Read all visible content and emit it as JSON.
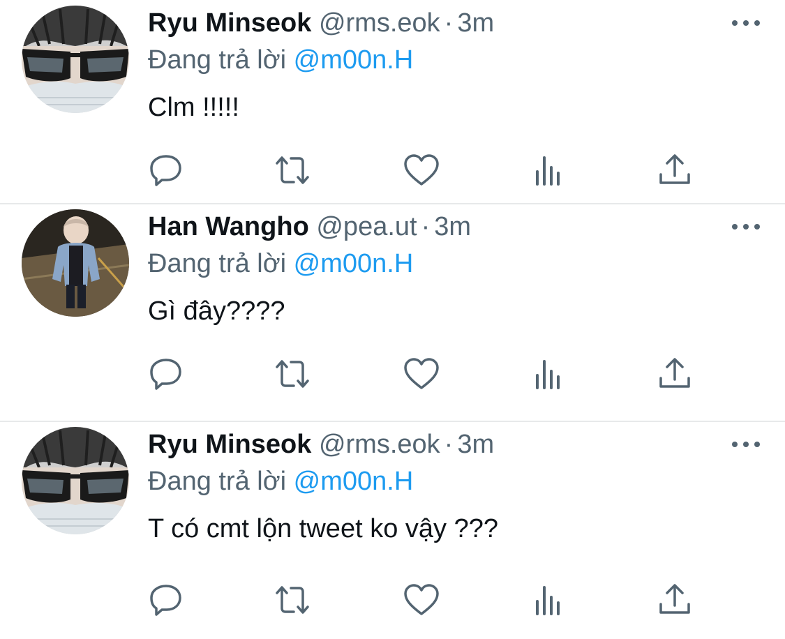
{
  "colors": {
    "text": "#0f1419",
    "secondary": "#536471",
    "link": "#1d9bf0",
    "divider": "#e7e9ea",
    "icon": "#536471"
  },
  "tweets": [
    {
      "name": "Ryu Minseok",
      "handle": "@rms.eok",
      "separator": "·",
      "time": "3m",
      "reply_prefix": "Đang trả lời",
      "reply_to": "@m00n.H",
      "text": "Clm !!!!!",
      "avatar": "avatar-sunglasses-mask"
    },
    {
      "name": "Han Wangho",
      "handle": "@pea.ut",
      "separator": "·",
      "time": "3m",
      "reply_prefix": "Đang trả lời",
      "reply_to": "@m00n.H",
      "text": "Gì đây????",
      "avatar": "avatar-street-photo"
    },
    {
      "name": "Ryu Minseok",
      "handle": "@rms.eok",
      "separator": "·",
      "time": "3m",
      "reply_prefix": "Đang trả lời",
      "reply_to": "@m00n.H",
      "text": "T có cmt lộn tweet ko vậy ???",
      "avatar": "avatar-sunglasses-mask"
    }
  ],
  "icons": {
    "more": "more-horizontal-icon",
    "reply": "reply-bubble-icon",
    "retweet": "retweet-icon",
    "like": "heart-icon",
    "views": "views-chart-icon",
    "share": "share-upload-icon"
  }
}
